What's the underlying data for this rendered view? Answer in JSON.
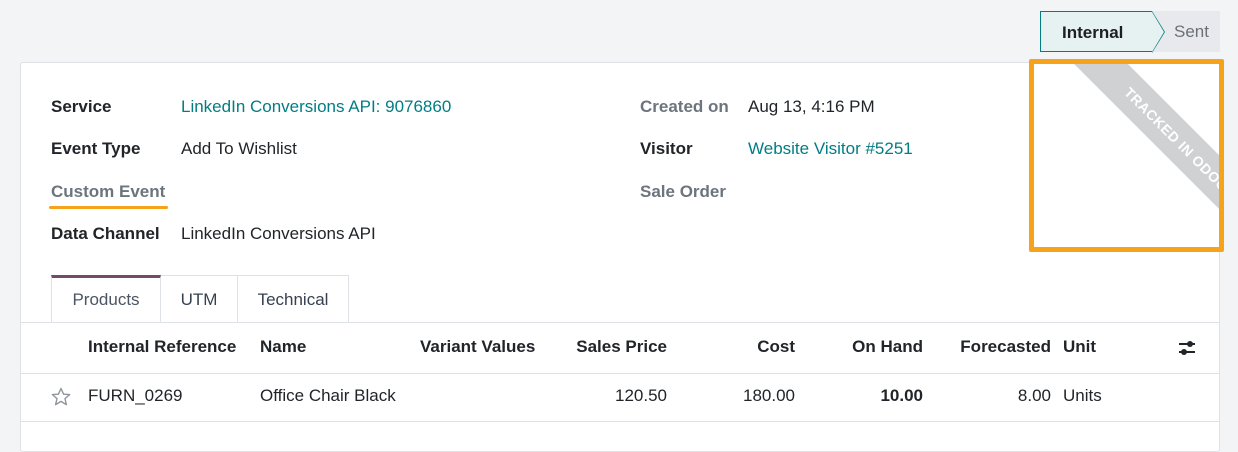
{
  "statusbar": {
    "steps": [
      {
        "label": "Internal",
        "active": true
      },
      {
        "label": "Sent",
        "active": false
      }
    ]
  },
  "ribbon": {
    "text": "TRACKED IN ODOO ONL"
  },
  "fields": {
    "service": {
      "label": "Service",
      "value": "LinkedIn Conversions API: 9076860"
    },
    "event_type": {
      "label": "Event Type",
      "value": "Add To Wishlist"
    },
    "custom_event": {
      "label": "Custom Event",
      "value": ""
    },
    "data_channel": {
      "label": "Data Channel",
      "value": "LinkedIn Conversions API"
    },
    "created_on": {
      "label": "Created on",
      "value": "Aug 13, 4:16 PM"
    },
    "visitor": {
      "label": "Visitor",
      "value": "Website Visitor #5251"
    },
    "sale_order": {
      "label": "Sale Order",
      "value": ""
    }
  },
  "tabs": [
    {
      "label": "Products",
      "active": true
    },
    {
      "label": "UTM",
      "active": false
    },
    {
      "label": "Technical",
      "active": false
    }
  ],
  "table": {
    "headers": {
      "internal_reference": "Internal Reference",
      "name": "Name",
      "variant_values": "Variant Values",
      "sales_price": "Sales Price",
      "cost": "Cost",
      "on_hand": "On Hand",
      "forecasted": "Forecasted",
      "unit": "Unit"
    },
    "rows": [
      {
        "internal_reference": "FURN_0269",
        "name": "Office Chair Black",
        "variant_values": "",
        "sales_price": "120.50",
        "cost": "180.00",
        "on_hand": "10.00",
        "forecasted": "8.00",
        "unit": "Units"
      }
    ]
  },
  "icons": {
    "favorite": "star-outline-icon",
    "columns": "sliders-icon"
  },
  "colors": {
    "accent": "#017e84",
    "highlight": "#f7a21b",
    "tab_active": "#714b67"
  }
}
